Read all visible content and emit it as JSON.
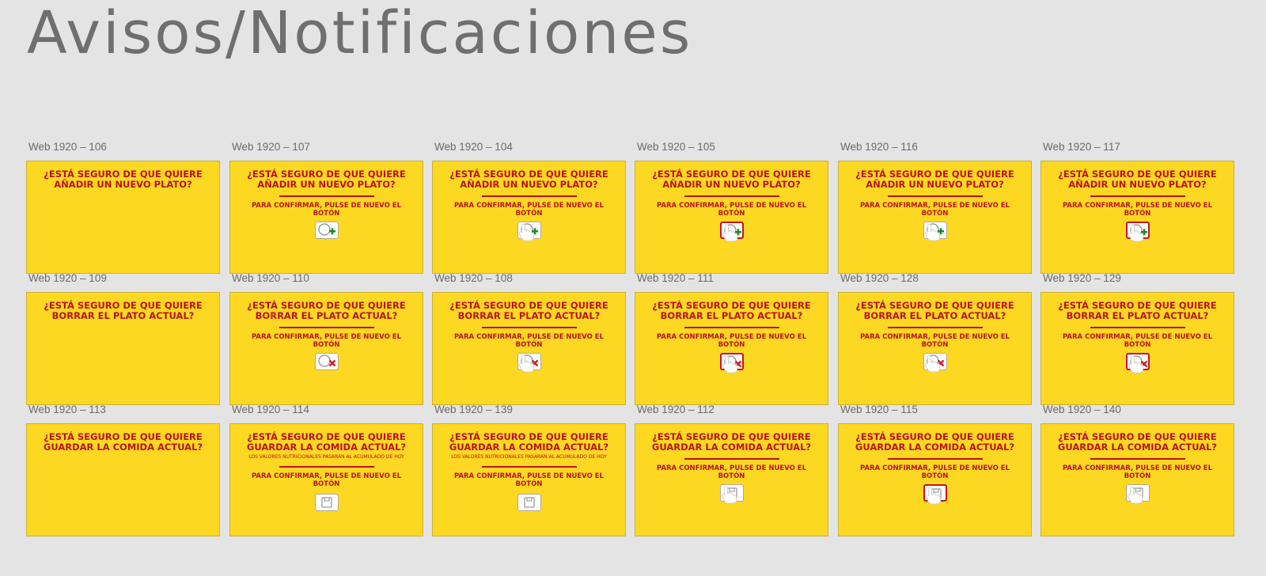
{
  "page": {
    "title": "Avisos/Notificaciones"
  },
  "messages": {
    "add": "¿ESTÁ SEGURO DE QUE QUIERE AÑADIR UN NUEVO PLATO?",
    "delete": "¿ESTÁ SEGURO DE QUE QUIERE BORRAR EL PLATO ACTUAL?",
    "save": "¿ESTÁ SEGURO DE QUE QUIERE GUARDAR LA COMIDA ACTUAL?",
    "note": "LOS VALORES NUTRICIONALES PASARÁN AL ACUMULADO DE HOY",
    "confirm": "PARA CONFIRMAR, PULSE DE NUEVO EL BOTÓN"
  },
  "colors": {
    "background": "#e4e4e4",
    "artboard": "#fdd822",
    "text": "#b8131f",
    "highlight": "#c4151d",
    "plus": "#1a8a2a"
  },
  "frames": [
    {
      "label": "Web 1920 – 106",
      "type": "add",
      "confirm": false,
      "note": false,
      "icon": "none",
      "hand": false,
      "highlight": false
    },
    {
      "label": "Web 1920 – 107",
      "type": "add",
      "confirm": true,
      "note": false,
      "icon": "add-plate-icon",
      "hand": false,
      "highlight": false
    },
    {
      "label": "Web 1920 – 104",
      "type": "add",
      "confirm": true,
      "note": false,
      "icon": "add-plate-icon",
      "hand": true,
      "highlight": false
    },
    {
      "label": "Web 1920 – 105",
      "type": "add",
      "confirm": true,
      "note": false,
      "icon": "add-plate-icon",
      "hand": true,
      "highlight": true
    },
    {
      "label": "Web 1920 – 116",
      "type": "add",
      "confirm": true,
      "note": false,
      "icon": "add-plate-icon",
      "hand": true,
      "highlight": false
    },
    {
      "label": "Web 1920 – 117",
      "type": "add",
      "confirm": true,
      "note": false,
      "icon": "add-plate-icon",
      "hand": true,
      "highlight": true
    },
    {
      "label": "Web 1920 – 109",
      "type": "delete",
      "confirm": false,
      "note": false,
      "icon": "none",
      "hand": false,
      "highlight": false
    },
    {
      "label": "Web 1920 – 110",
      "type": "delete",
      "confirm": true,
      "note": false,
      "icon": "delete-plate-icon",
      "hand": false,
      "highlight": false
    },
    {
      "label": "Web 1920 – 108",
      "type": "delete",
      "confirm": true,
      "note": false,
      "icon": "delete-plate-icon",
      "hand": true,
      "highlight": false
    },
    {
      "label": "Web 1920 – 111",
      "type": "delete",
      "confirm": true,
      "note": false,
      "icon": "delete-plate-icon",
      "hand": true,
      "highlight": true
    },
    {
      "label": "Web 1920 – 128",
      "type": "delete",
      "confirm": true,
      "note": false,
      "icon": "delete-plate-icon",
      "hand": true,
      "highlight": false
    },
    {
      "label": "Web 1920 – 129",
      "type": "delete",
      "confirm": true,
      "note": false,
      "icon": "delete-plate-icon",
      "hand": true,
      "highlight": true
    },
    {
      "label": "Web 1920 – 113",
      "type": "save",
      "confirm": false,
      "note": false,
      "icon": "none",
      "hand": false,
      "highlight": false
    },
    {
      "label": "Web 1920 – 114",
      "type": "save",
      "confirm": true,
      "note": true,
      "icon": "save-icon",
      "hand": false,
      "highlight": false
    },
    {
      "label": "Web 1920 – 139",
      "type": "save",
      "confirm": true,
      "note": true,
      "icon": "save-icon",
      "hand": false,
      "highlight": false
    },
    {
      "label": "Web 1920 – 112",
      "type": "save",
      "confirm": true,
      "note": false,
      "icon": "save-icon",
      "hand": true,
      "highlight": false
    },
    {
      "label": "Web 1920 – 115",
      "type": "save",
      "confirm": true,
      "note": false,
      "icon": "save-icon",
      "hand": true,
      "highlight": true
    },
    {
      "label": "Web 1920 – 140",
      "type": "save",
      "confirm": true,
      "note": false,
      "icon": "save-icon",
      "hand": true,
      "highlight": false
    }
  ]
}
